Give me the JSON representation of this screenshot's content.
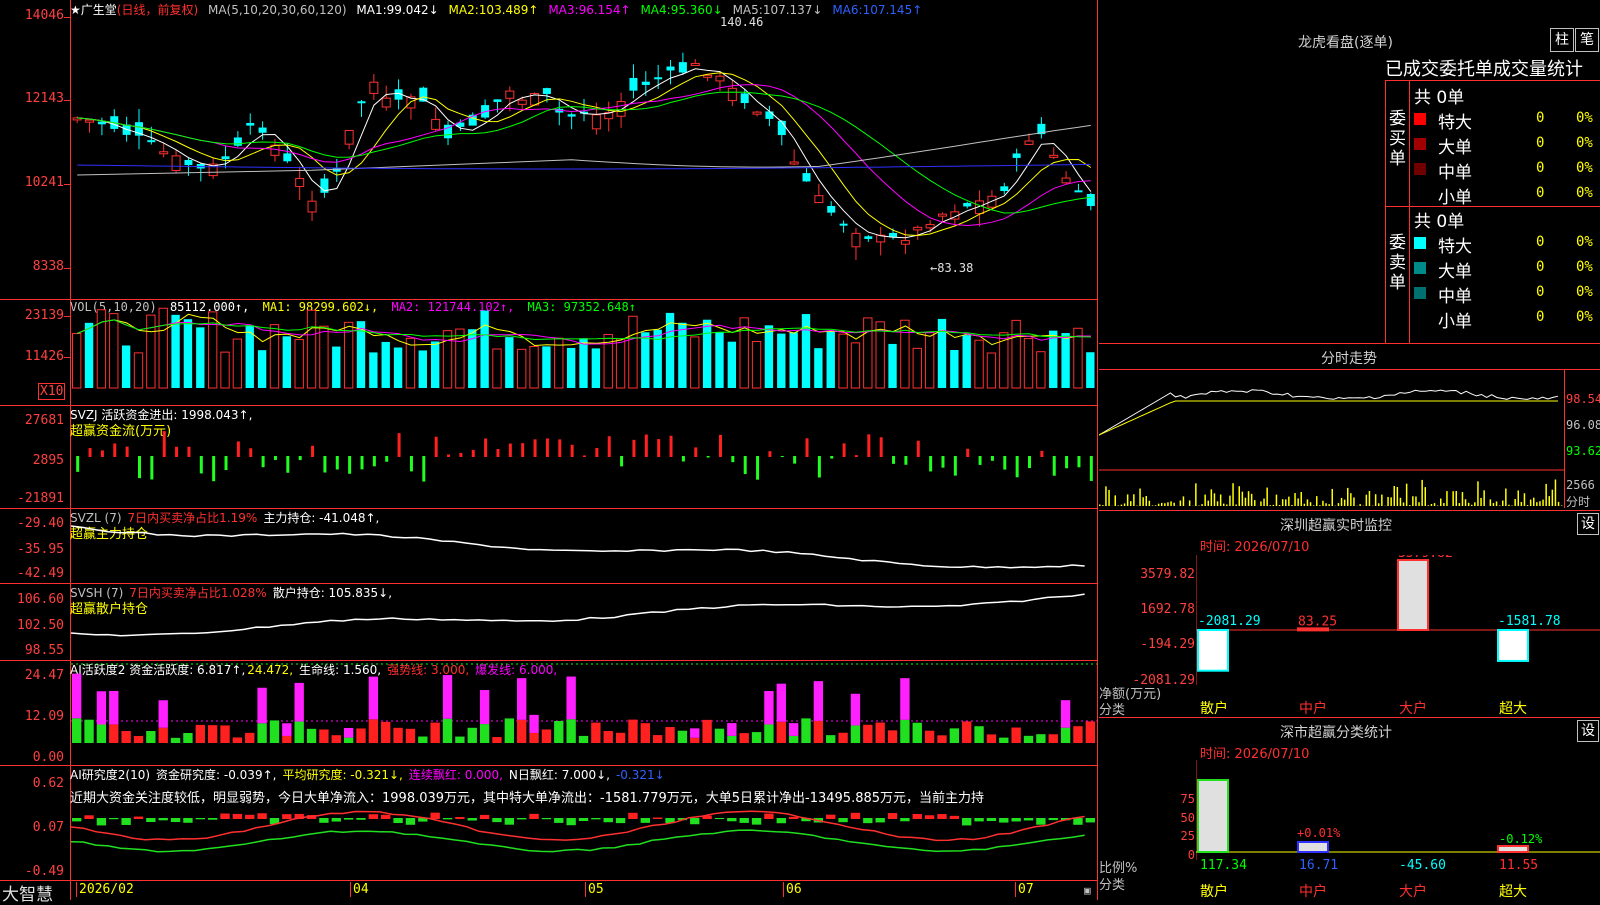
{
  "main": {
    "title": "★广生堂",
    "mode": "(日线，前复权)",
    "ma_header": "MA(5,10,20,30,60,120)",
    "ma": [
      {
        "label": "MA1:",
        "value": "99.042↓",
        "color": "#ffffff"
      },
      {
        "label": "MA2:",
        "value": "103.489↑",
        "color": "#ffff00"
      },
      {
        "label": "MA3:",
        "value": "96.154↑",
        "color": "#ff00ff"
      },
      {
        "label": "MA4:",
        "value": "95.360↓",
        "color": "#00ff00"
      },
      {
        "label": "MA5:",
        "value": "107.137↓",
        "color": "#c0c0c0"
      },
      {
        "label": "MA6:",
        "value": "107.145↑",
        "color": "#0000ff"
      }
    ],
    "y_labels": [
      "14046",
      "12143",
      "10241",
      "8338"
    ],
    "high_marker": "140.46",
    "low_marker": "←83.38"
  },
  "vol": {
    "header": "VOL(5,10,20)",
    "value": "85112.000↑,",
    "ma1": "MA1: 98299.602↓,",
    "ma2": "MA2: 121744.102↑,",
    "ma3": "MA3: 97352.648↑",
    "y_labels": [
      "23139",
      "11426"
    ],
    "unit": "X10"
  },
  "svzj": {
    "header": "SVZJ  活跃资金进出: 1998.043↑,",
    "subtitle": "超赢资金流(万元)",
    "y_labels": [
      "27681",
      "2895",
      "-21891"
    ]
  },
  "svzl": {
    "header_a": "SVZL (7)",
    "header_b": "7日内买卖净占比1.19%",
    "header_c": "主力持仓: -41.048↑,",
    "subtitle": "超赢主力持仓",
    "y_labels": [
      "-29.40",
      "-35.95",
      "-42.49"
    ]
  },
  "svsh": {
    "header_a": "SVSH (7)",
    "header_b": "7日内买卖净占比1.028%",
    "header_c": "散户持仓: 105.835↓,",
    "subtitle": "超赢散户持仓",
    "y_labels": [
      "106.60",
      "102.50",
      "98.55"
    ]
  },
  "ai1": {
    "header_a": "AI活跃度2 资金活跃度: 6.817↑,",
    "header_b": "24.472,",
    "header_c": "生命线: 1.560,",
    "header_d": "强势线: 3.000,",
    "header_e": "爆发线: 6.000,",
    "y_labels": [
      "24.47",
      "12.09",
      "0.00"
    ]
  },
  "ai2": {
    "header_a": "AI研究度2(10)",
    "header_b": "资金研究度: -0.039↑,",
    "header_c": "平均研究度: -0.321↓,",
    "header_d": "连续飘红: 0.000,",
    "header_e": "N日飘红: 7.000↓,",
    "header_f": "-0.321↓",
    "text": "近期大资金关注度较低，明显弱势，今日大单净流入：1998.039万元，其中特大单净流出：-1581.779万元，大单5日累计净出-13495.885万元，当前主力持",
    "y_labels": [
      "0.62",
      "0.07",
      "-0.49"
    ]
  },
  "bottom": {
    "brand": "大智慧",
    "dates": [
      "2026/02",
      "04",
      "05",
      "06",
      "07"
    ]
  },
  "right": {
    "lhb_title": "龙虎看盘(逐单)",
    "btn1": "柱",
    "btn2": "笔",
    "section_title": "已成交委托单成交量统计",
    "buy_label": "委买单",
    "sell_label": "委卖单",
    "buy_total": "共 0单",
    "sell_total": "共 0单",
    "buy_rows": [
      {
        "name": "特大",
        "val": "0",
        "pct": "0%",
        "color": "#ff0000"
      },
      {
        "name": "大单",
        "val": "0",
        "pct": "0%",
        "color": "#a00000"
      },
      {
        "name": "中单",
        "val": "0",
        "pct": "0%",
        "color": "#700000"
      },
      {
        "name": "小单",
        "val": "0",
        "pct": "0%",
        "color": "#000000"
      }
    ],
    "sell_rows": [
      {
        "name": "特大",
        "val": "0",
        "pct": "0%",
        "color": "#00ffff"
      },
      {
        "name": "大单",
        "val": "0",
        "pct": "0%",
        "color": "#008b8b"
      },
      {
        "name": "中单",
        "val": "0",
        "pct": "0%",
        "color": "#007070"
      },
      {
        "name": "小单",
        "val": "0",
        "pct": "0%",
        "color": "#000000"
      }
    ],
    "fs_title": "分时走势",
    "fs_labels": [
      "98.54",
      "96.08",
      "93.62",
      "2566",
      "分时"
    ],
    "monitor_title": "深圳超赢实时监控",
    "monitor_btn": "设",
    "monitor_time": "时间: 2026/07/10",
    "monitor_y": [
      "3579.82",
      "1692.78",
      "-194.29",
      "-2081.29"
    ],
    "monitor_bars": [
      {
        "label": "-2081.29",
        "value": -2081.29
      },
      {
        "label": "83.25",
        "value": 83.25
      },
      {
        "label": "3579.82",
        "value": 3579.82
      },
      {
        "label": "-1581.78",
        "value": -1581.78
      }
    ],
    "monitor_unit": "净额(万元)",
    "monitor_fl": "分类",
    "cats": [
      "散户",
      "中户",
      "大户",
      "超大"
    ],
    "stat_title": "深市超赢分类统计",
    "stat_btn": "设",
    "stat_time": "时间: 2026/07/10",
    "stat_y": [
      "75",
      "50",
      "25",
      "0"
    ],
    "stat_bar_labels": [
      "+0.01%",
      "-0.12%"
    ],
    "stat_vals": [
      "117.34",
      "16.71",
      "-45.60",
      "11.55"
    ],
    "stat_unit": "比例%",
    "stat_fl": "分类"
  }
}
